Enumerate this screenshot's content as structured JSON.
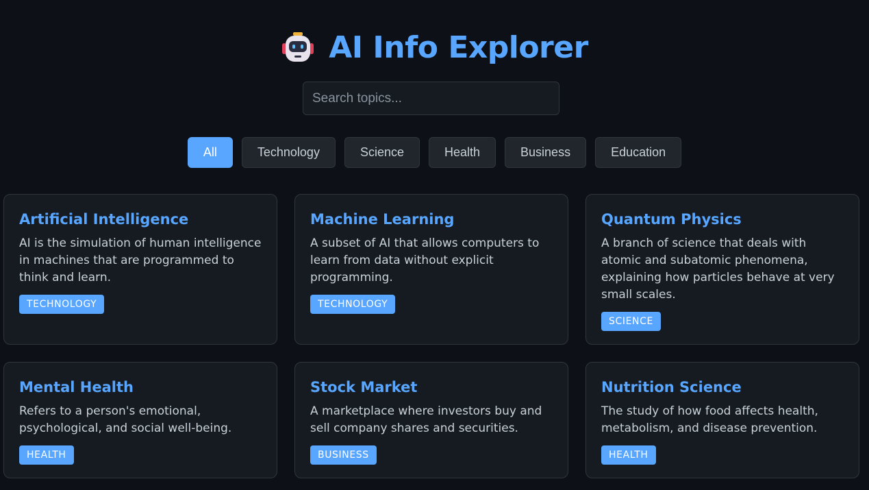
{
  "header": {
    "title": "AI Info Explorer",
    "icon": "robot-icon"
  },
  "search": {
    "placeholder": "Search topics...",
    "value": ""
  },
  "filters": [
    {
      "label": "All",
      "active": true
    },
    {
      "label": "Technology",
      "active": false
    },
    {
      "label": "Science",
      "active": false
    },
    {
      "label": "Health",
      "active": false
    },
    {
      "label": "Business",
      "active": false
    },
    {
      "label": "Education",
      "active": false
    }
  ],
  "cards": [
    {
      "title": "Artificial Intelligence",
      "description": "AI is the simulation of human intelligence in machines that are programmed to think and learn.",
      "tag": "TECHNOLOGY"
    },
    {
      "title": "Machine Learning",
      "description": "A subset of AI that allows computers to learn from data without explicit programming.",
      "tag": "TECHNOLOGY"
    },
    {
      "title": "Quantum Physics",
      "description": "A branch of science that deals with atomic and subatomic phenomena, explaining how particles behave at very small scales.",
      "tag": "SCIENCE"
    },
    {
      "title": "Mental Health",
      "description": "Refers to a person's emotional, psychological, and social well-being.",
      "tag": "HEALTH"
    },
    {
      "title": "Stock Market",
      "description": "A marketplace where investors buy and sell company shares and securities.",
      "tag": "BUSINESS"
    },
    {
      "title": "Nutrition Science",
      "description": "The study of how food affects health, metabolism, and disease prevention.",
      "tag": "HEALTH"
    }
  ],
  "colors": {
    "background": "#0d1117",
    "accent": "#58a6ff",
    "card": "#161b22",
    "border": "#30363d",
    "button": "#21262d"
  }
}
